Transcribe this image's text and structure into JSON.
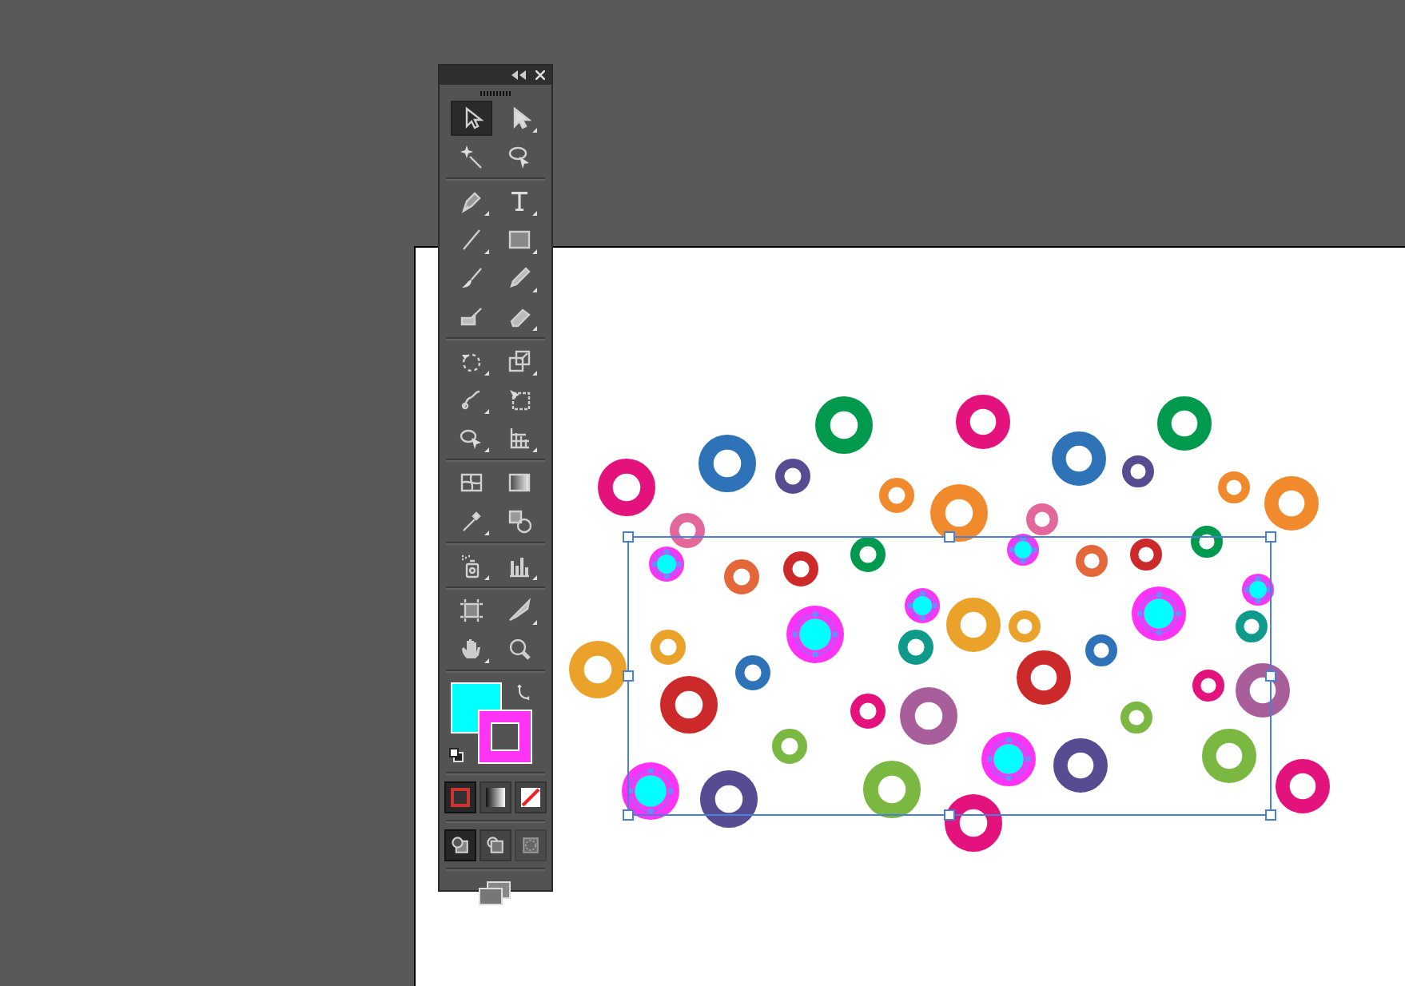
{
  "tool_panel": {
    "tool_groups": [
      {
        "tools": [
          {
            "kind": "selection",
            "selected": true,
            "flyout": false
          },
          {
            "kind": "direct-selection",
            "selected": false,
            "flyout": true
          },
          {
            "kind": "magic-wand",
            "selected": false,
            "flyout": false
          },
          {
            "kind": "lasso",
            "selected": false,
            "flyout": false
          }
        ]
      },
      {
        "tools": [
          {
            "kind": "pen",
            "selected": false,
            "flyout": true
          },
          {
            "kind": "type",
            "selected": false,
            "flyout": true
          },
          {
            "kind": "line",
            "selected": false,
            "flyout": true
          },
          {
            "kind": "rectangle",
            "selected": false,
            "flyout": true
          },
          {
            "kind": "paintbrush",
            "selected": false,
            "flyout": false
          },
          {
            "kind": "pencil",
            "selected": false,
            "flyout": true
          },
          {
            "kind": "blob-brush",
            "selected": false,
            "flyout": false
          },
          {
            "kind": "eraser",
            "selected": false,
            "flyout": true
          }
        ]
      },
      {
        "tools": [
          {
            "kind": "rotate",
            "selected": false,
            "flyout": true
          },
          {
            "kind": "scale",
            "selected": false,
            "flyout": true
          },
          {
            "kind": "warp",
            "selected": false,
            "flyout": true
          },
          {
            "kind": "free-transform",
            "selected": false,
            "flyout": false
          },
          {
            "kind": "shape-builder",
            "selected": false,
            "flyout": true
          },
          {
            "kind": "perspective",
            "selected": false,
            "flyout": true
          }
        ]
      },
      {
        "tools": [
          {
            "kind": "mesh",
            "selected": false,
            "flyout": false
          },
          {
            "kind": "gradient",
            "selected": false,
            "flyout": false
          },
          {
            "kind": "eyedropper",
            "selected": false,
            "flyout": true
          },
          {
            "kind": "blend",
            "selected": false,
            "flyout": false
          }
        ]
      },
      {
        "tools": [
          {
            "kind": "symbol-sprayer",
            "selected": false,
            "flyout": true
          },
          {
            "kind": "column-graph",
            "selected": false,
            "flyout": true
          }
        ]
      },
      {
        "tools": [
          {
            "kind": "artboard",
            "selected": false,
            "flyout": false
          },
          {
            "kind": "slice",
            "selected": false,
            "flyout": true
          },
          {
            "kind": "hand",
            "selected": false,
            "flyout": true
          },
          {
            "kind": "zoom",
            "selected": false,
            "flyout": false
          }
        ]
      }
    ],
    "swatches": [
      {
        "kind": "fill",
        "color": "#00ffff"
      },
      {
        "kind": "stroke",
        "color": "#ff33f5"
      }
    ],
    "color_modes": [
      {
        "kind": "color",
        "selected": true
      },
      {
        "kind": "gradient",
        "selected": false
      },
      {
        "kind": "none",
        "selected": false
      }
    ],
    "draw_modes": [
      {
        "kind": "normal",
        "selected": true,
        "disabled": false
      },
      {
        "kind": "behind",
        "selected": false,
        "disabled": false
      },
      {
        "kind": "inside",
        "selected": false,
        "disabled": true
      }
    ]
  },
  "artboard": {
    "circles": [
      {
        "color": "#e3127c",
        "selected": false
      },
      {
        "color": "#2e72b8",
        "selected": false
      },
      {
        "color": "#009a4e",
        "selected": false
      },
      {
        "color": "#e3127c",
        "selected": false
      },
      {
        "color": "#2e72b8",
        "selected": false
      },
      {
        "color": "#009a4e",
        "selected": false
      },
      {
        "color": "#574b92",
        "selected": false
      },
      {
        "color": "#574b92",
        "selected": false
      },
      {
        "color": "#f08a2c",
        "selected": false
      },
      {
        "color": "#f08a2c",
        "selected": false
      },
      {
        "color": "#f08a2c",
        "selected": false
      },
      {
        "color": "#f08a2c",
        "selected": false
      },
      {
        "color": "#e2679a",
        "selected": false
      },
      {
        "color": "#e2679a",
        "selected": false
      },
      {
        "color": "#ff33f5",
        "selected": true
      },
      {
        "color": "#e4673a",
        "selected": false
      },
      {
        "color": "#cc2a2a",
        "selected": false
      },
      {
        "color": "#009a4e",
        "selected": false
      },
      {
        "color": "#ff33f5",
        "selected": true
      },
      {
        "color": "#e4673a",
        "selected": false
      },
      {
        "color": "#cc2a2a",
        "selected": false
      },
      {
        "color": "#009a4e",
        "selected": false
      },
      {
        "color": "#ff33f5",
        "selected": true
      },
      {
        "color": "#ff33f5",
        "selected": true
      },
      {
        "color": "#ff33f5",
        "selected": true
      },
      {
        "color": "#ff33f5",
        "selected": true
      },
      {
        "color": "#eaa22a",
        "selected": false
      },
      {
        "color": "#eaa22a",
        "selected": false
      },
      {
        "color": "#eaa22a",
        "selected": false
      },
      {
        "color": "#eaa22a",
        "selected": false
      },
      {
        "color": "#109a8c",
        "selected": false
      },
      {
        "color": "#109a8c",
        "selected": false
      },
      {
        "color": "#2e72b8",
        "selected": false
      },
      {
        "color": "#2e72b8",
        "selected": false
      },
      {
        "color": "#cc2a2a",
        "selected": false
      },
      {
        "color": "#cc2a2a",
        "selected": false
      },
      {
        "color": "#e3127c",
        "selected": false
      },
      {
        "color": "#a85e9a",
        "selected": false
      },
      {
        "color": "#e3127c",
        "selected": false
      },
      {
        "color": "#a85e9a",
        "selected": false
      },
      {
        "color": "#7ab842",
        "selected": false
      },
      {
        "color": "#7ab842",
        "selected": false
      },
      {
        "color": "#ff33f5",
        "selected": true
      },
      {
        "color": "#574b92",
        "selected": false
      },
      {
        "color": "#7ab842",
        "selected": false
      },
      {
        "color": "#ff33f5",
        "selected": true
      },
      {
        "color": "#574b92",
        "selected": false
      },
      {
        "color": "#7ab842",
        "selected": false
      },
      {
        "color": "#e3127c",
        "selected": false
      },
      {
        "color": "#e3127c",
        "selected": false
      }
    ]
  }
}
